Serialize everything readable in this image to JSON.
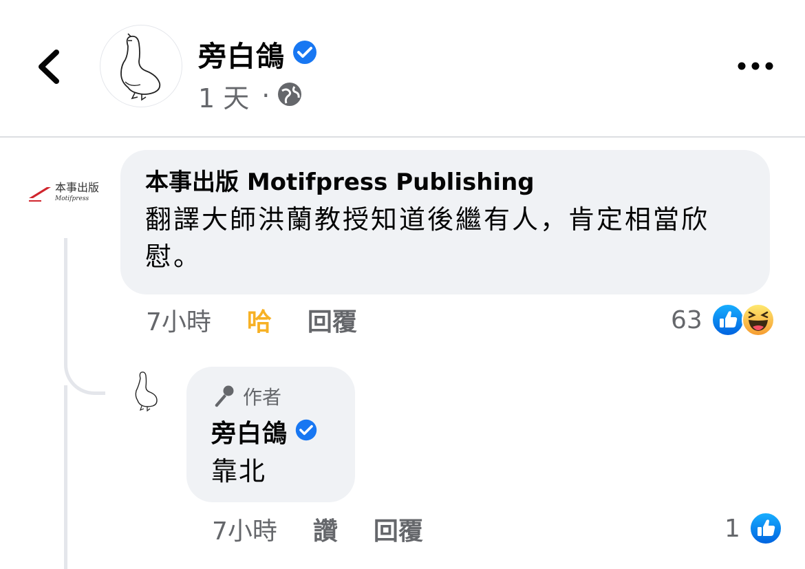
{
  "header": {
    "back_icon": "chevron-left-icon",
    "poster_name": "旁白鴿",
    "verified_icon": "verified-badge-icon",
    "post_time": "1 天",
    "separator": "·",
    "audience_icon": "globe-icon",
    "more_icon": "more-dots-icon"
  },
  "comments": [
    {
      "logo_text": "本事出版",
      "logo_subtext": "Motifpress",
      "author": "本事出版 Motifpress Publishing",
      "text": "翻譯大師洪蘭教授知道後繼有人，肯定相當欣慰。",
      "time": "7小時",
      "reaction_label": "哈",
      "reply_label": "回覆",
      "reaction_count": "63",
      "reaction_icons": [
        "like-reaction-icon",
        "haha-reaction-icon"
      ],
      "colors": {
        "reaction_active": "#f7b125"
      }
    },
    {
      "badge_label": "作者",
      "badge_icon": "microphone-icon",
      "author": "旁白鴿",
      "text": "靠北",
      "time": "7小時",
      "like_label": "讚",
      "reply_label": "回覆",
      "reaction_count": "1",
      "reaction_icons": [
        "like-reaction-icon"
      ]
    }
  ],
  "colors": {
    "verified_blue": "#1877f2",
    "bubble_bg": "#f0f2f5",
    "secondary_text": "#65676b",
    "logo_red": "#d0252d"
  }
}
